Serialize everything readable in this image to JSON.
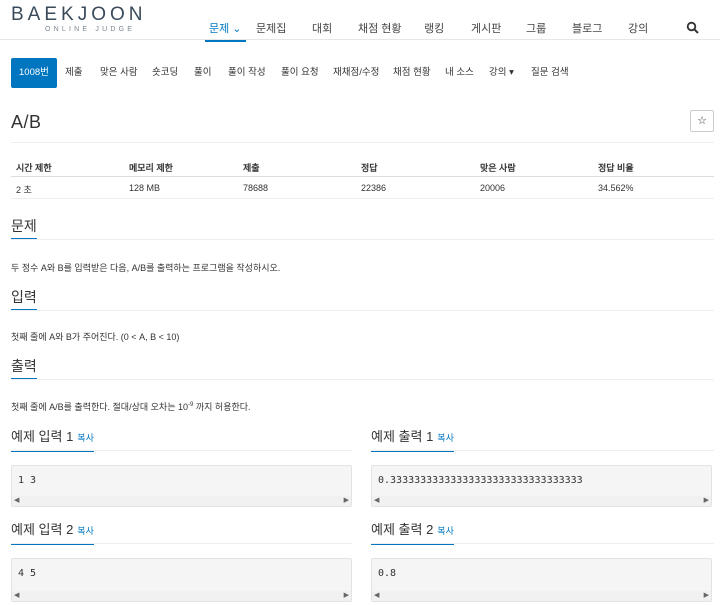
{
  "logo": {
    "main": "BAEKJOON",
    "sub": "ONLINE JUDGE"
  },
  "nav": {
    "items": [
      {
        "label": "문제 ⌄",
        "active": true
      },
      {
        "label": "문제집"
      },
      {
        "label": "대회"
      },
      {
        "label": "채점 현황"
      },
      {
        "label": "랭킹"
      },
      {
        "label": "게시판"
      },
      {
        "label": "그룹"
      },
      {
        "label": "블로그"
      },
      {
        "label": "강의"
      }
    ],
    "search_icon": "search-icon"
  },
  "subtabs": [
    {
      "label": "1008번",
      "active": true
    },
    {
      "label": "제출"
    },
    {
      "label": "맞은 사람"
    },
    {
      "label": "숏코딩"
    },
    {
      "label": "풀이"
    },
    {
      "label": "풀이 작성"
    },
    {
      "label": "풀이 요청"
    },
    {
      "label": "재채점/수정"
    },
    {
      "label": "채점 현황"
    },
    {
      "label": "내 소스"
    },
    {
      "label": "강의 ▾"
    },
    {
      "label": "질문 검색"
    }
  ],
  "problem": {
    "title": "A/B",
    "star": "☆",
    "info_headers": [
      "시간 제한",
      "메모리 제한",
      "제출",
      "정답",
      "맞은 사람",
      "정답 비율"
    ],
    "info_values": [
      "2 초",
      "128 MB",
      "78688",
      "22386",
      "20006",
      "34.562%"
    ]
  },
  "sections": {
    "problem_title": "문제",
    "problem_text": "두 정수 A와 B를 입력받은 다음, A/B를 출력하는 프로그램을 작성하시오.",
    "input_title": "입력",
    "input_text": "첫째 줄에 A와 B가 주어진다. (0 < A, B < 10)",
    "output_title": "출력",
    "output_text_pre": "첫째 줄에 A/B를 출력한다. 절대/상대 오차는 10",
    "output_text_sup": "-9",
    "output_text_post": " 까지 허용한다."
  },
  "examples": {
    "copy_label": "복사",
    "input1_title": "예제 입력 1",
    "input1": "1 3",
    "output1_title": "예제 출력 1",
    "output1": "0.33333333333333333333333333333333",
    "input2_title": "예제 입력 2",
    "input2": "4 5",
    "output2_title": "예제 출력 2",
    "output2": "0.8"
  }
}
